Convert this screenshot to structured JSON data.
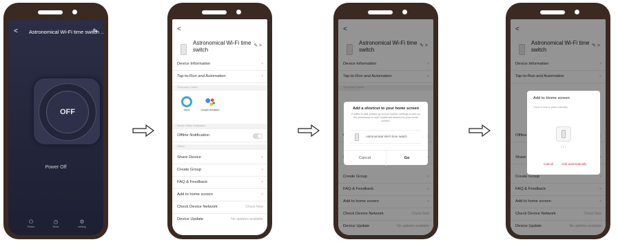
{
  "phone1": {
    "title": "Astronomical Wi-Fi time switch ...",
    "back": "<",
    "edit": "✎",
    "power_state": "OFF",
    "status": "Power Off",
    "buttons": [
      {
        "label": "Power",
        "icon": "power-icon",
        "glyph": "⏻"
      },
      {
        "label": "Timer",
        "icon": "timer-icon",
        "glyph": "◷"
      },
      {
        "label": "setting",
        "icon": "gear-icon",
        "glyph": "⚙"
      }
    ]
  },
  "device": {
    "title": "Astronomical Wi-Fi time switch",
    "back": "<",
    "edit": "✎ >"
  },
  "menu": {
    "device_info": "Device Information",
    "tap_to_run": "Tap-to-Run and Automation",
    "third_party_header": "Third-party Control",
    "alexa": "Alexa",
    "google": "Google Assistant",
    "offline_header": "Device Offline Notification",
    "offline": "Offline Notification",
    "others_header": "Others",
    "share": "Share Device",
    "create_group": "Create Group",
    "faq": "FAQ & Feedback",
    "add_home": "Add to home screen",
    "check_network": "Check Device Network",
    "check_now": "Check Now",
    "update": "Device Update",
    "no_updates": "No updates available",
    "chevron": ">"
  },
  "dialog1": {
    "title": "Add a shortcut to your home screen",
    "body": "If failed to add, please go to your system settings to turn on the permission to add TuyaSmart shortcut to your home screen.",
    "device": "Astronomical Wi-Fi time switch",
    "cancel": "Cancel",
    "go": "Go"
  },
  "dialog2": {
    "title": "Add to Home screen",
    "hint": "Touch & hold to place manually",
    "size": "1 x 1",
    "cancel": "Cancel",
    "add": "Add automatically"
  },
  "colors": {
    "accent_red": "#e0263a",
    "dark_bg": "#24263c",
    "frame": "#3a2a22"
  }
}
